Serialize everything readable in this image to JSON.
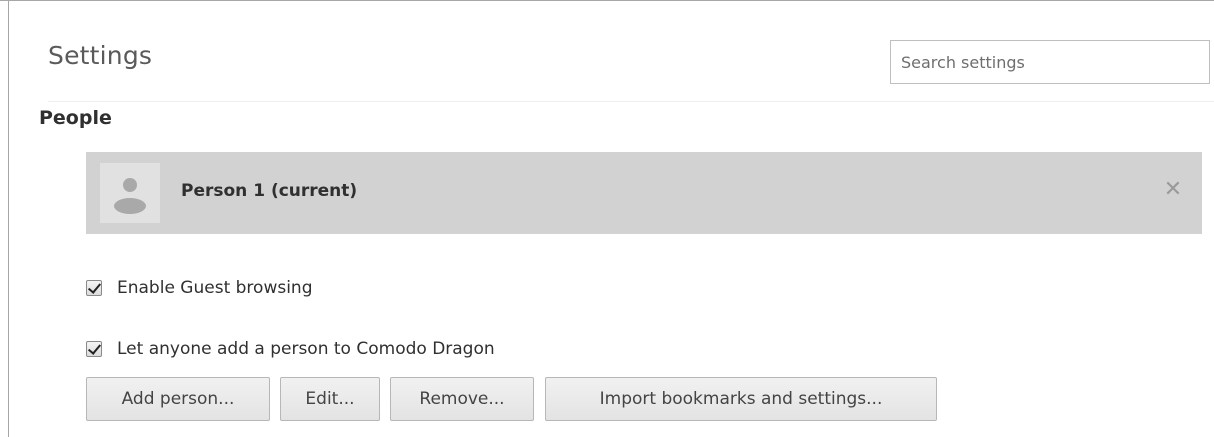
{
  "header": {
    "title": "Settings",
    "search_placeholder": "Search settings"
  },
  "people": {
    "section_title": "People",
    "profile": {
      "name": "Person 1 (current)",
      "avatar_icon": "person-silhouette-icon",
      "remove_icon": "close-icon"
    },
    "options": [
      {
        "label": "Enable Guest browsing",
        "checked": true
      },
      {
        "label": "Let anyone add a person to Comodo Dragon",
        "checked": true
      }
    ],
    "buttons": {
      "add": "Add person...",
      "edit": "Edit...",
      "remove": "Remove...",
      "import": "Import bookmarks and settings..."
    }
  },
  "colors": {
    "profile_row_bg": "#d2d2d2",
    "button_border": "#b7b7b7",
    "text": "#303030"
  }
}
